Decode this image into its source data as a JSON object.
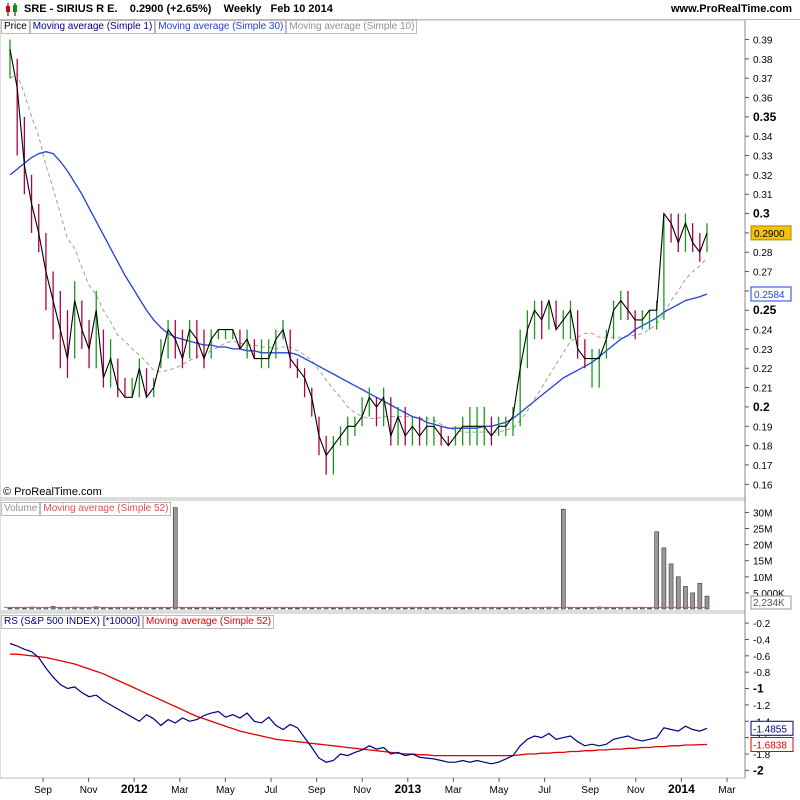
{
  "header": {
    "title": "SRE - SIRIUS R E.",
    "quote": "0.2900 (+2.65%)",
    "period": "Weekly",
    "date": "Feb 10 2014",
    "site": "www.ProRealTime.com"
  },
  "price_panel": {
    "tags": [
      "Price",
      "Moving average (Simple 1)",
      "Moving average (Simple 30)",
      "Moving average (Simple 10)"
    ],
    "tag_colors": [
      "#000000",
      "#000080",
      "#2040e0",
      "#909090"
    ],
    "last_price_label": "0.2900",
    "ma30_label": "0.2584",
    "copyright": "© ProRealTime.com"
  },
  "volume_panel": {
    "tags": [
      "Volume",
      "Moving average (Simple 52)"
    ],
    "tag_colors": [
      "#909090",
      "#e05050"
    ],
    "last_volume_label": "2,234K"
  },
  "rs_panel": {
    "tags": [
      "RS (S&P 500 INDEX) [*10000]",
      "Moving average (Simple 52)"
    ],
    "tag_colors": [
      "#000080",
      "#e00000"
    ],
    "rs_label": "-1.4855",
    "ma_label": "-1.6838"
  },
  "colors": {
    "up": "#1a9a1a",
    "down": "#b0004a",
    "ma1": "#000000",
    "ma30": "#2040e0",
    "ma10": "#a0a0a0",
    "rs": "#000080",
    "rs_ma": "#e00000",
    "price_tag": "#f4c20d"
  },
  "chart_data": [
    {
      "type": "line",
      "title": "Price",
      "x_ticks": [
        "Sep",
        "Nov",
        "2012",
        "Mar",
        "May",
        "Jul",
        "Sep",
        "Nov",
        "2013",
        "Mar",
        "May",
        "Jul",
        "Sep",
        "Nov",
        "2014",
        "Mar"
      ],
      "y_ticks": [
        "0.39",
        "0.38",
        "0.37",
        "0.36",
        "0.35",
        "0.34",
        "0.33",
        "0.32",
        "0.31",
        "0.3",
        "0.29",
        "0.28",
        "0.27",
        "0.26",
        "0.25",
        "0.24",
        "0.23",
        "0.22",
        "0.21",
        "0.2",
        "0.19",
        "0.18",
        "0.17",
        "0.16"
      ],
      "y_bold_ticks": [
        "0.35",
        "0.3",
        "0.25",
        "0.2"
      ],
      "ylim": [
        0.156,
        0.397
      ],
      "close": [
        0.385,
        0.365,
        0.325,
        0.305,
        0.29,
        0.27,
        0.255,
        0.24,
        0.225,
        0.255,
        0.24,
        0.23,
        0.25,
        0.215,
        0.225,
        0.21,
        0.205,
        0.205,
        0.22,
        0.205,
        0.21,
        0.225,
        0.24,
        0.235,
        0.225,
        0.24,
        0.235,
        0.225,
        0.235,
        0.24,
        0.24,
        0.24,
        0.23,
        0.235,
        0.225,
        0.225,
        0.225,
        0.235,
        0.24,
        0.225,
        0.22,
        0.215,
        0.205,
        0.185,
        0.175,
        0.18,
        0.185,
        0.19,
        0.19,
        0.195,
        0.205,
        0.2,
        0.205,
        0.185,
        0.195,
        0.185,
        0.19,
        0.185,
        0.19,
        0.19,
        0.185,
        0.18,
        0.185,
        0.19,
        0.19,
        0.19,
        0.19,
        0.185,
        0.19,
        0.19,
        0.195,
        0.22,
        0.24,
        0.25,
        0.245,
        0.255,
        0.24,
        0.245,
        0.25,
        0.23,
        0.225,
        0.225,
        0.225,
        0.235,
        0.25,
        0.255,
        0.25,
        0.245,
        0.245,
        0.25,
        0.25,
        0.3,
        0.295,
        0.285,
        0.295,
        0.285,
        0.28,
        0.29
      ],
      "high": [
        0.39,
        0.38,
        0.35,
        0.32,
        0.305,
        0.29,
        0.27,
        0.26,
        0.25,
        0.265,
        0.255,
        0.245,
        0.26,
        0.24,
        0.235,
        0.225,
        0.215,
        0.215,
        0.225,
        0.22,
        0.215,
        0.235,
        0.245,
        0.245,
        0.24,
        0.245,
        0.245,
        0.24,
        0.24,
        0.24,
        0.24,
        0.24,
        0.24,
        0.24,
        0.235,
        0.235,
        0.235,
        0.24,
        0.245,
        0.24,
        0.225,
        0.22,
        0.21,
        0.195,
        0.185,
        0.185,
        0.19,
        0.195,
        0.195,
        0.205,
        0.21,
        0.205,
        0.21,
        0.205,
        0.2,
        0.2,
        0.195,
        0.195,
        0.195,
        0.195,
        0.19,
        0.185,
        0.19,
        0.195,
        0.2,
        0.2,
        0.2,
        0.195,
        0.195,
        0.195,
        0.2,
        0.24,
        0.25,
        0.255,
        0.255,
        0.255,
        0.255,
        0.25,
        0.255,
        0.25,
        0.235,
        0.23,
        0.23,
        0.24,
        0.255,
        0.26,
        0.26,
        0.25,
        0.25,
        0.25,
        0.255,
        0.3,
        0.3,
        0.3,
        0.3,
        0.295,
        0.29,
        0.295
      ],
      "low": [
        0.37,
        0.33,
        0.31,
        0.29,
        0.28,
        0.25,
        0.235,
        0.22,
        0.215,
        0.225,
        0.23,
        0.22,
        0.22,
        0.21,
        0.21,
        0.205,
        0.205,
        0.205,
        0.205,
        0.205,
        0.205,
        0.22,
        0.225,
        0.225,
        0.22,
        0.225,
        0.225,
        0.22,
        0.225,
        0.235,
        0.235,
        0.235,
        0.23,
        0.225,
        0.225,
        0.22,
        0.22,
        0.225,
        0.235,
        0.22,
        0.215,
        0.205,
        0.195,
        0.175,
        0.165,
        0.165,
        0.18,
        0.18,
        0.185,
        0.19,
        0.195,
        0.19,
        0.19,
        0.18,
        0.18,
        0.18,
        0.18,
        0.18,
        0.18,
        0.18,
        0.18,
        0.18,
        0.18,
        0.18,
        0.18,
        0.18,
        0.18,
        0.18,
        0.185,
        0.185,
        0.185,
        0.19,
        0.22,
        0.235,
        0.235,
        0.24,
        0.24,
        0.235,
        0.235,
        0.225,
        0.22,
        0.21,
        0.21,
        0.225,
        0.235,
        0.245,
        0.245,
        0.235,
        0.24,
        0.24,
        0.24,
        0.245,
        0.285,
        0.28,
        0.28,
        0.28,
        0.275,
        0.28
      ],
      "ma10": [
        0.37,
        0.372,
        0.362,
        0.35,
        0.34,
        0.325,
        0.313,
        0.3,
        0.287,
        0.282,
        0.272,
        0.263,
        0.258,
        0.25,
        0.244,
        0.237,
        0.234,
        0.23,
        0.227,
        0.223,
        0.219,
        0.218,
        0.219,
        0.22,
        0.222,
        0.224,
        0.226,
        0.227,
        0.229,
        0.231,
        0.233,
        0.234,
        0.233,
        0.232,
        0.232,
        0.231,
        0.231,
        0.23,
        0.231,
        0.231,
        0.229,
        0.227,
        0.224,
        0.219,
        0.214,
        0.209,
        0.205,
        0.2,
        0.197,
        0.195,
        0.194,
        0.194,
        0.195,
        0.195,
        0.195,
        0.195,
        0.195,
        0.194,
        0.194,
        0.193,
        0.191,
        0.189,
        0.188,
        0.187,
        0.187,
        0.187,
        0.187,
        0.187,
        0.187,
        0.188,
        0.189,
        0.193,
        0.198,
        0.204,
        0.21,
        0.216,
        0.222,
        0.228,
        0.234,
        0.236,
        0.238,
        0.238,
        0.236,
        0.236,
        0.236,
        0.236,
        0.237,
        0.237,
        0.238,
        0.24,
        0.243,
        0.248,
        0.255,
        0.26,
        0.266,
        0.27,
        0.273,
        0.277
      ],
      "ma30": [
        0.32,
        0.323,
        0.326,
        0.329,
        0.331,
        0.332,
        0.331,
        0.327,
        0.322,
        0.316,
        0.31,
        0.303,
        0.296,
        0.289,
        0.282,
        0.275,
        0.268,
        0.262,
        0.256,
        0.25,
        0.245,
        0.241,
        0.238,
        0.236,
        0.235,
        0.234,
        0.233,
        0.232,
        0.232,
        0.231,
        0.231,
        0.23,
        0.23,
        0.229,
        0.229,
        0.228,
        0.228,
        0.228,
        0.228,
        0.228,
        0.227,
        0.225,
        0.223,
        0.221,
        0.219,
        0.217,
        0.215,
        0.213,
        0.211,
        0.209,
        0.207,
        0.205,
        0.203,
        0.201,
        0.199,
        0.197,
        0.195,
        0.194,
        0.192,
        0.191,
        0.19,
        0.189,
        0.189,
        0.189,
        0.189,
        0.189,
        0.19,
        0.19,
        0.191,
        0.192,
        0.194,
        0.197,
        0.2,
        0.203,
        0.206,
        0.209,
        0.212,
        0.215,
        0.217,
        0.219,
        0.221,
        0.223,
        0.226,
        0.229,
        0.232,
        0.235,
        0.237,
        0.24,
        0.242,
        0.244,
        0.246,
        0.249,
        0.251,
        0.253,
        0.255,
        0.256,
        0.257,
        0.2584
      ]
    },
    {
      "type": "bar",
      "title": "Volume",
      "y_ticks": [
        "30M",
        "25M",
        "20M",
        "15M",
        "10M",
        "5,000K"
      ],
      "ylim": [
        0,
        32
      ],
      "unit": "M",
      "values": [
        0.3,
        0.4,
        0.3,
        0.6,
        0.5,
        0.4,
        0.8,
        0.5,
        0.4,
        0.6,
        0.4,
        0.5,
        0.7,
        0.4,
        0.3,
        0.4,
        0.5,
        0.3,
        0.4,
        0.4,
        0.3,
        0.4,
        0.3,
        0.6,
        0.4,
        0.4,
        0.3,
        0.4,
        0.3,
        0.3,
        0.4,
        0.3,
        0.4,
        0.3,
        0.4,
        0.3,
        0.3,
        0.4,
        0.3,
        0.3,
        0.3,
        0.4,
        0.3,
        0.5,
        0.4,
        0.3,
        0.3,
        0.4,
        0.3,
        0.3,
        0.4,
        0.3,
        0.3,
        0.4,
        0.3,
        0.3,
        0.3,
        0.4,
        0.3,
        0.4,
        0.3,
        0.4,
        0.3,
        0.3,
        0.4,
        0.3,
        0.5,
        0.4,
        0.3,
        0.3,
        0.4,
        0.5,
        0.3,
        0.4,
        0.4,
        0.6,
        0.4,
        0.3,
        0.4,
        0.3,
        0.3,
        0.4,
        0.6,
        0.4,
        0.3,
        0.5,
        0.4,
        0.3,
        0.4,
        0.3,
        0.5,
        0.6,
        0.4,
        0.5,
        0.6,
        0.8,
        0.7,
        2.2
      ],
      "spikes": [
        {
          "index": 23,
          "value": 31.5
        },
        {
          "index": 77,
          "value": 31
        },
        {
          "index": 90,
          "value": 24
        },
        {
          "index": 91,
          "value": 19
        },
        {
          "index": 92,
          "value": 14
        },
        {
          "index": 93,
          "value": 10
        },
        {
          "index": 94,
          "value": 7
        },
        {
          "index": 95,
          "value": 5
        },
        {
          "index": 96,
          "value": 8
        },
        {
          "index": 97,
          "value": 4
        }
      ],
      "ma52": 0.5
    },
    {
      "type": "line",
      "title": "RS (S&P 500 INDEX) [*10000]",
      "y_ticks": [
        "-0.2",
        "-0.4",
        "-0.6",
        "-0.8",
        "-1",
        "-1.2",
        "-1.4",
        "-1.6",
        "-1.8",
        "-2"
      ],
      "y_bold_ticks": [
        "-1",
        "-2"
      ],
      "ylim": [
        -2.02,
        -0.15
      ],
      "rs": [
        -0.45,
        -0.48,
        -0.52,
        -0.55,
        -0.62,
        -0.75,
        -0.86,
        -0.95,
        -1.0,
        -0.98,
        -1.05,
        -1.1,
        -1.08,
        -1.15,
        -1.2,
        -1.25,
        -1.3,
        -1.35,
        -1.4,
        -1.32,
        -1.37,
        -1.45,
        -1.38,
        -1.42,
        -1.36,
        -1.4,
        -1.38,
        -1.33,
        -1.3,
        -1.28,
        -1.35,
        -1.32,
        -1.36,
        -1.3,
        -1.4,
        -1.42,
        -1.35,
        -1.45,
        -1.5,
        -1.44,
        -1.48,
        -1.6,
        -1.72,
        -1.85,
        -1.9,
        -1.88,
        -1.8,
        -1.82,
        -1.78,
        -1.75,
        -1.7,
        -1.74,
        -1.72,
        -1.8,
        -1.78,
        -1.82,
        -1.8,
        -1.84,
        -1.85,
        -1.86,
        -1.88,
        -1.9,
        -1.9,
        -1.88,
        -1.9,
        -1.88,
        -1.9,
        -1.92,
        -1.9,
        -1.86,
        -1.82,
        -1.7,
        -1.62,
        -1.58,
        -1.6,
        -1.55,
        -1.62,
        -1.6,
        -1.58,
        -1.65,
        -1.7,
        -1.68,
        -1.7,
        -1.68,
        -1.62,
        -1.6,
        -1.58,
        -1.62,
        -1.64,
        -1.62,
        -1.6,
        -1.48,
        -1.5,
        -1.52,
        -1.46,
        -1.5,
        -1.52,
        -1.4855
      ],
      "ma52": [
        -0.58,
        -0.58,
        -0.59,
        -0.6,
        -0.61,
        -0.62,
        -0.64,
        -0.66,
        -0.68,
        -0.7,
        -0.73,
        -0.76,
        -0.79,
        -0.82,
        -0.86,
        -0.9,
        -0.94,
        -0.98,
        -1.02,
        -1.06,
        -1.1,
        -1.14,
        -1.18,
        -1.22,
        -1.26,
        -1.3,
        -1.34,
        -1.37,
        -1.4,
        -1.43,
        -1.46,
        -1.49,
        -1.52,
        -1.54,
        -1.56,
        -1.58,
        -1.6,
        -1.62,
        -1.63,
        -1.64,
        -1.65,
        -1.66,
        -1.67,
        -1.68,
        -1.69,
        -1.7,
        -1.71,
        -1.72,
        -1.73,
        -1.74,
        -1.75,
        -1.76,
        -1.77,
        -1.78,
        -1.79,
        -1.8,
        -1.8,
        -1.81,
        -1.81,
        -1.82,
        -1.82,
        -1.82,
        -1.82,
        -1.82,
        -1.82,
        -1.82,
        -1.82,
        -1.82,
        -1.82,
        -1.82,
        -1.82,
        -1.81,
        -1.8,
        -1.8,
        -1.79,
        -1.79,
        -1.78,
        -1.78,
        -1.77,
        -1.77,
        -1.76,
        -1.76,
        -1.75,
        -1.75,
        -1.74,
        -1.74,
        -1.73,
        -1.73,
        -1.72,
        -1.72,
        -1.71,
        -1.71,
        -1.7,
        -1.7,
        -1.69,
        -1.69,
        -1.685,
        -1.6838
      ]
    }
  ]
}
